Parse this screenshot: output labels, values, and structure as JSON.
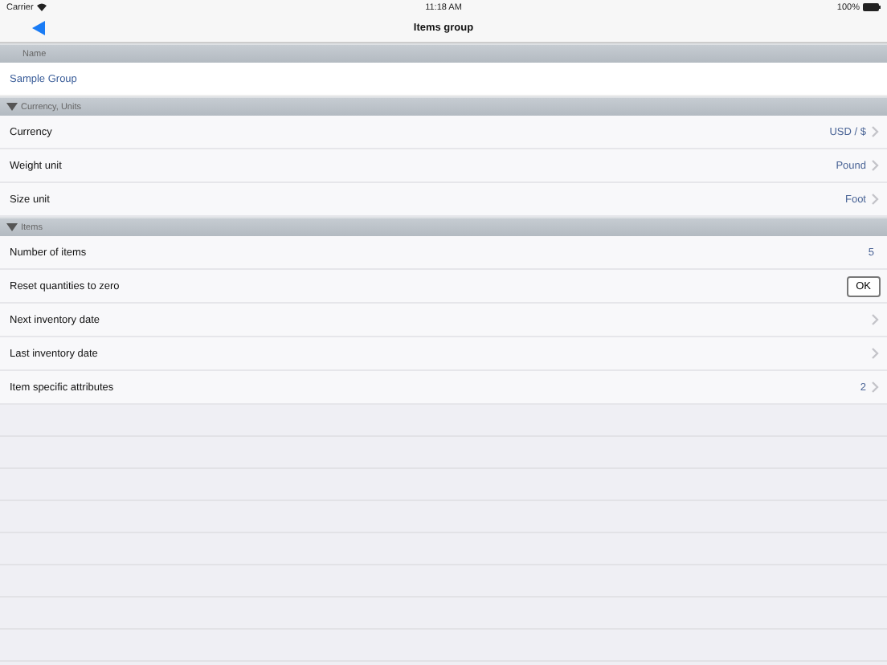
{
  "status_bar": {
    "carrier": "Carrier",
    "time": "11:18 AM",
    "battery": "100%"
  },
  "nav_bar": {
    "title": "Items group"
  },
  "sections": [
    {
      "kind": "field",
      "title": "Name",
      "value": "Sample Group"
    },
    {
      "kind": "list",
      "title": "Currency, Units",
      "expanded": true,
      "rows": [
        {
          "kind": "detail",
          "label": "Currency",
          "value": "USD / $",
          "chevron": true
        },
        {
          "kind": "detail",
          "label": "Weight unit",
          "value": "Pound",
          "chevron": true
        },
        {
          "kind": "detail",
          "label": "Size unit",
          "value": "Foot",
          "chevron": true
        }
      ]
    },
    {
      "kind": "list",
      "title": "Items",
      "expanded": true,
      "rows": [
        {
          "kind": "detail",
          "label": "Number of items",
          "value": "5",
          "chevron": false
        },
        {
          "kind": "button",
          "label": "Reset quantities to zero",
          "button": "OK"
        },
        {
          "kind": "detail",
          "label": "Next inventory date",
          "chevron": true
        },
        {
          "kind": "detail",
          "label": "Last inventory date",
          "chevron": true
        },
        {
          "kind": "detail",
          "label": "Item specific attributes",
          "value": "2",
          "chevron": true
        }
      ]
    }
  ]
}
